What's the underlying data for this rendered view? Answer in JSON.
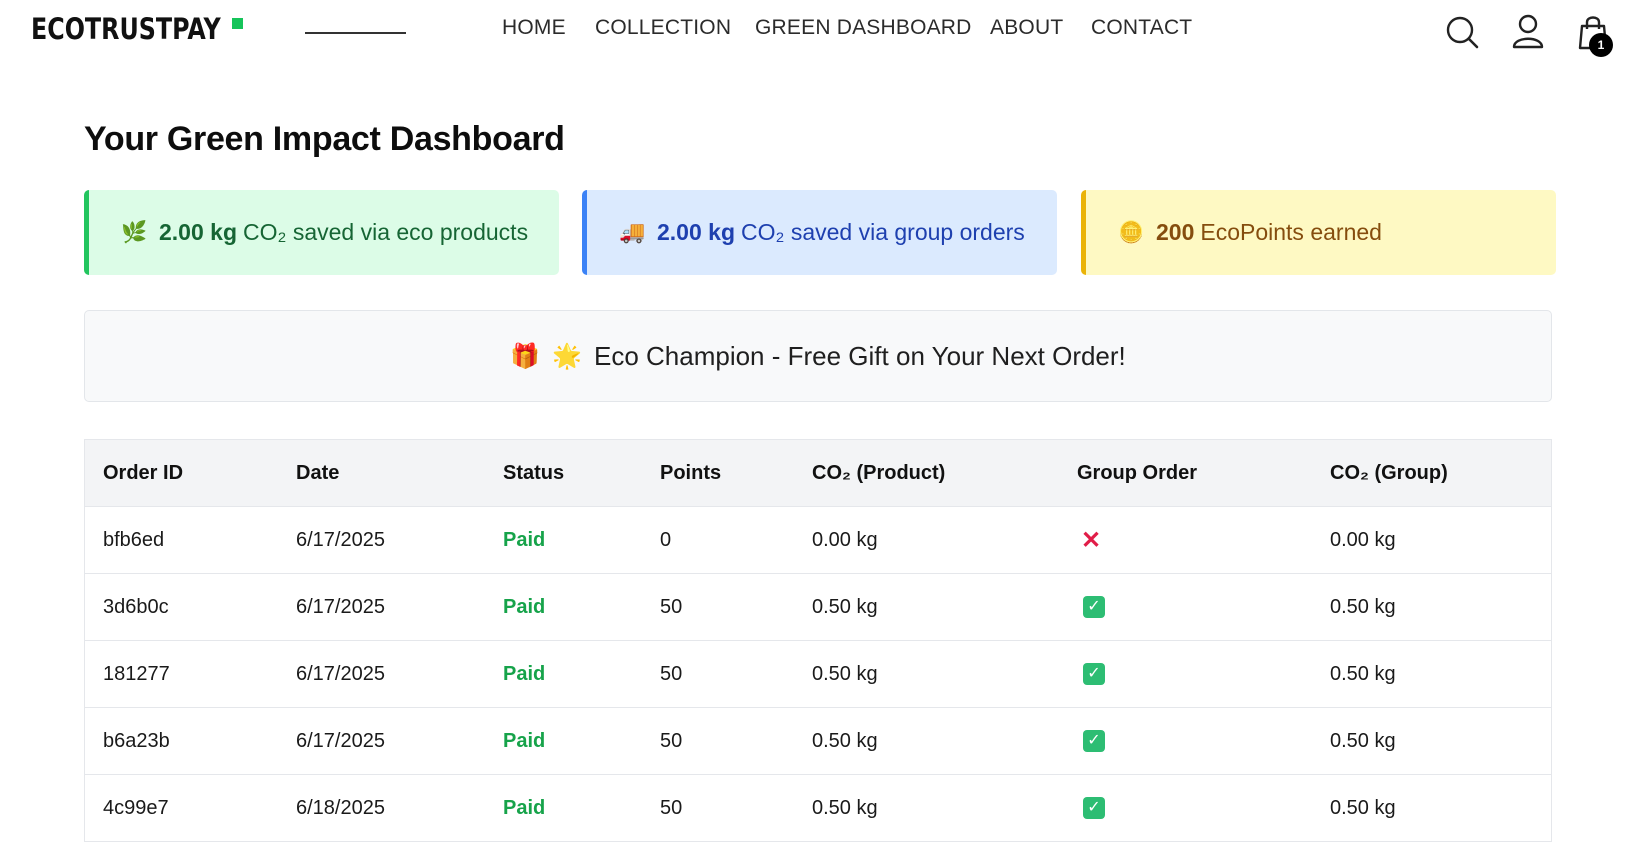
{
  "brand": {
    "logo_text": "ECOTRUSTPAY",
    "accent": "#16c45a"
  },
  "nav": {
    "home": "HOME",
    "collection": "COLLECTION",
    "dashboard": "GREEN DASHBOARD",
    "about": "ABOUT",
    "contact": "CONTACT",
    "active": "GREEN DASHBOARD"
  },
  "header_icons": {
    "search": "search-icon",
    "user": "user-icon",
    "cart": "shopping-bag-icon",
    "cart_count": "1"
  },
  "page_title": "Your Green Impact Dashboard",
  "cards": {
    "eco": {
      "emoji": "🌿",
      "value": "2.00 kg",
      "text": "CO₂ saved via eco products",
      "color": "#22c55e"
    },
    "group": {
      "emoji": "🚚",
      "value": "2.00 kg",
      "text": "CO₂ saved via group orders",
      "color": "#3b82f6"
    },
    "points": {
      "emoji": "🪙",
      "value": "200",
      "text": "EcoPoints earned",
      "color": "#eab308"
    }
  },
  "banner": {
    "emoji1": "🎁",
    "emoji2": "🌟",
    "text": "Eco Champion - Free Gift on Your Next Order!"
  },
  "table": {
    "headers": [
      "Order ID",
      "Date",
      "Status",
      "Points",
      "CO₂ (Product)",
      "Group Order",
      "CO₂ (Group)"
    ],
    "rows": [
      {
        "id": "bfb6ed",
        "date": "6/17/2025",
        "status": "Paid",
        "points": "0",
        "co2_product": "0.00 kg",
        "group": "✕",
        "co2_group": "0.00 kg"
      },
      {
        "id": "3d6b0c",
        "date": "6/17/2025",
        "status": "Paid",
        "points": "50",
        "co2_product": "0.50 kg",
        "group": "✓",
        "co2_group": "0.50 kg"
      },
      {
        "id": "181277",
        "date": "6/17/2025",
        "status": "Paid",
        "points": "50",
        "co2_product": "0.50 kg",
        "group": "✓",
        "co2_group": "0.50 kg"
      },
      {
        "id": "b6a23b",
        "date": "6/17/2025",
        "status": "Paid",
        "points": "50",
        "co2_product": "0.50 kg",
        "group": "✓",
        "co2_group": "0.50 kg"
      },
      {
        "id": "4c99e7",
        "date": "6/18/2025",
        "status": "Paid",
        "points": "50",
        "co2_product": "0.50 kg",
        "group": "✓",
        "co2_group": "0.50 kg"
      }
    ]
  }
}
